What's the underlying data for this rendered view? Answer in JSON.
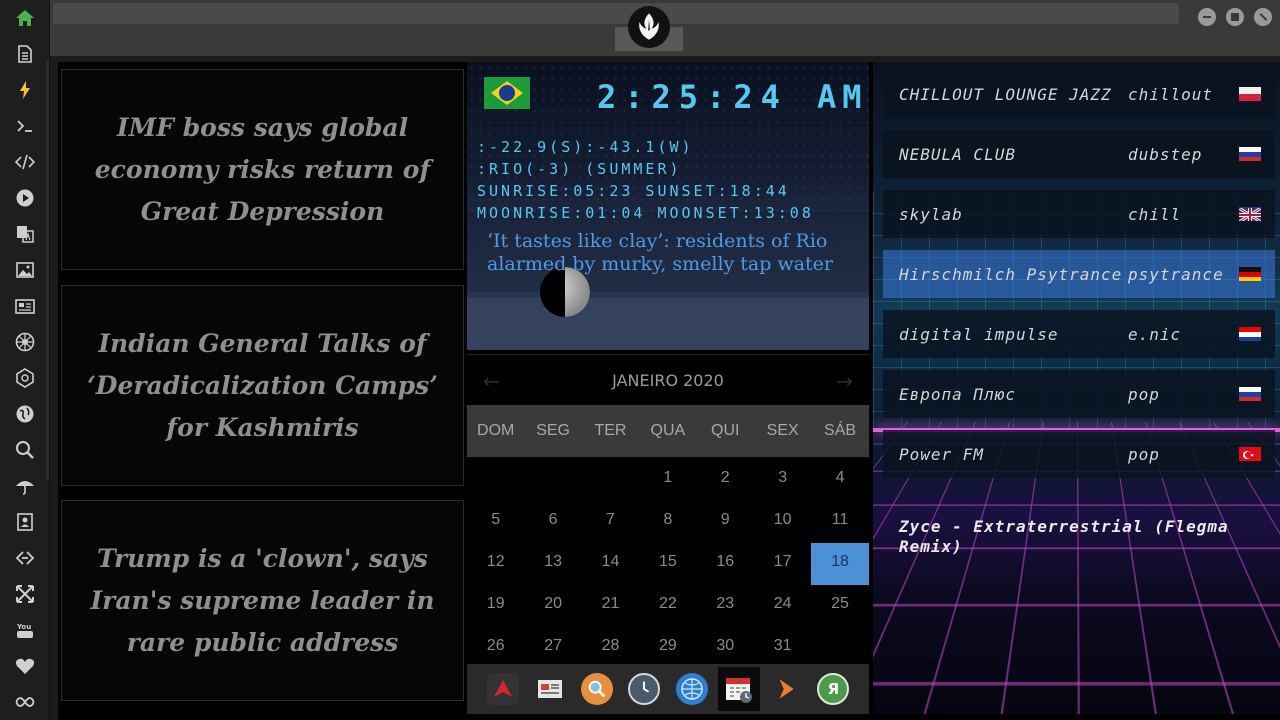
{
  "sidebar": {
    "icons": [
      "home-icon",
      "document-icon",
      "lightning-icon",
      "terminal-icon",
      "code-icon",
      "play-icon",
      "translate-icon",
      "image-icon",
      "news-icon",
      "rebel-alliance-icon",
      "galactic-empire-icon",
      "globe-icon",
      "search-icon",
      "umbrella-icon",
      "contacts-icon",
      "link-icon",
      "expand-icon",
      "youtube-icon",
      "heart-icon",
      "infinity-icon"
    ],
    "active_color": "#4caf50"
  },
  "news": {
    "items": [
      "IMF boss says global economy risks return of Great Depression",
      "Indian General Talks of ‘Deradicalization Camps’ for Kashmiris",
      "Trump is a 'clown', says Iran's supreme leader in rare public address"
    ]
  },
  "clock": {
    "time": "2:25:24",
    "ampm": "AM",
    "coords": ":-22.9(S):-43.1(W)",
    "location": ":RIO(-3) (SUMMER)",
    "sun": "SUNRISE:05:23 SUNSET:18:44",
    "moon": "MOONRISE:01:04 MOONSET:13:08",
    "headline": "‘It tastes like clay’: residents of Rio alarmed by murky, smelly tap water",
    "flag": "Brazil"
  },
  "calendar": {
    "title": "JANEIRO 2020",
    "days": [
      "DOM",
      "SEG",
      "TER",
      "QUA",
      "QUI",
      "SEX",
      "SÁB"
    ],
    "weeks": [
      [
        "",
        "",
        "",
        "1",
        "2",
        "3",
        "4"
      ],
      [
        "5",
        "6",
        "7",
        "8",
        "9",
        "10",
        "11"
      ],
      [
        "12",
        "13",
        "14",
        "15",
        "16",
        "17",
        "18"
      ],
      [
        "19",
        "20",
        "21",
        "22",
        "23",
        "24",
        "25"
      ],
      [
        "26",
        "27",
        "28",
        "29",
        "30",
        "31",
        ""
      ]
    ],
    "today": "18",
    "prev_arrow": "←",
    "next_arrow": "→"
  },
  "dock": {
    "items": [
      "arch-icon",
      "news-reader-icon",
      "search-app-icon",
      "clock-app-icon",
      "browser-globe-icon",
      "calendar-app-icon",
      "media-player-icon",
      "yandex-icon"
    ],
    "yandex_label": "Я"
  },
  "radio": {
    "stations": [
      {
        "name": "CHILLOUT LOUNGE JAZZ",
        "genre": "chillout",
        "flag": "Poland"
      },
      {
        "name": "NEBULA CLUB",
        "genre": "dubstep",
        "flag": "Russia"
      },
      {
        "name": "skylab",
        "genre": "chill",
        "flag": "United Kingdom"
      },
      {
        "name": "Hirschmilch Psytrance",
        "genre": "psytrance",
        "flag": "Germany"
      },
      {
        "name": "digital impulse",
        "genre": "e.nic",
        "flag": "Croatia"
      },
      {
        "name": "Европа Плюс",
        "genre": "pop",
        "flag": "Russia"
      },
      {
        "name": "Power FM",
        "genre": "pop",
        "flag": "Turkey"
      }
    ],
    "selected": "Hirschmilch Psytrance",
    "now_playing": "Zyce - Extraterrestrial (Flegma Remix)"
  }
}
